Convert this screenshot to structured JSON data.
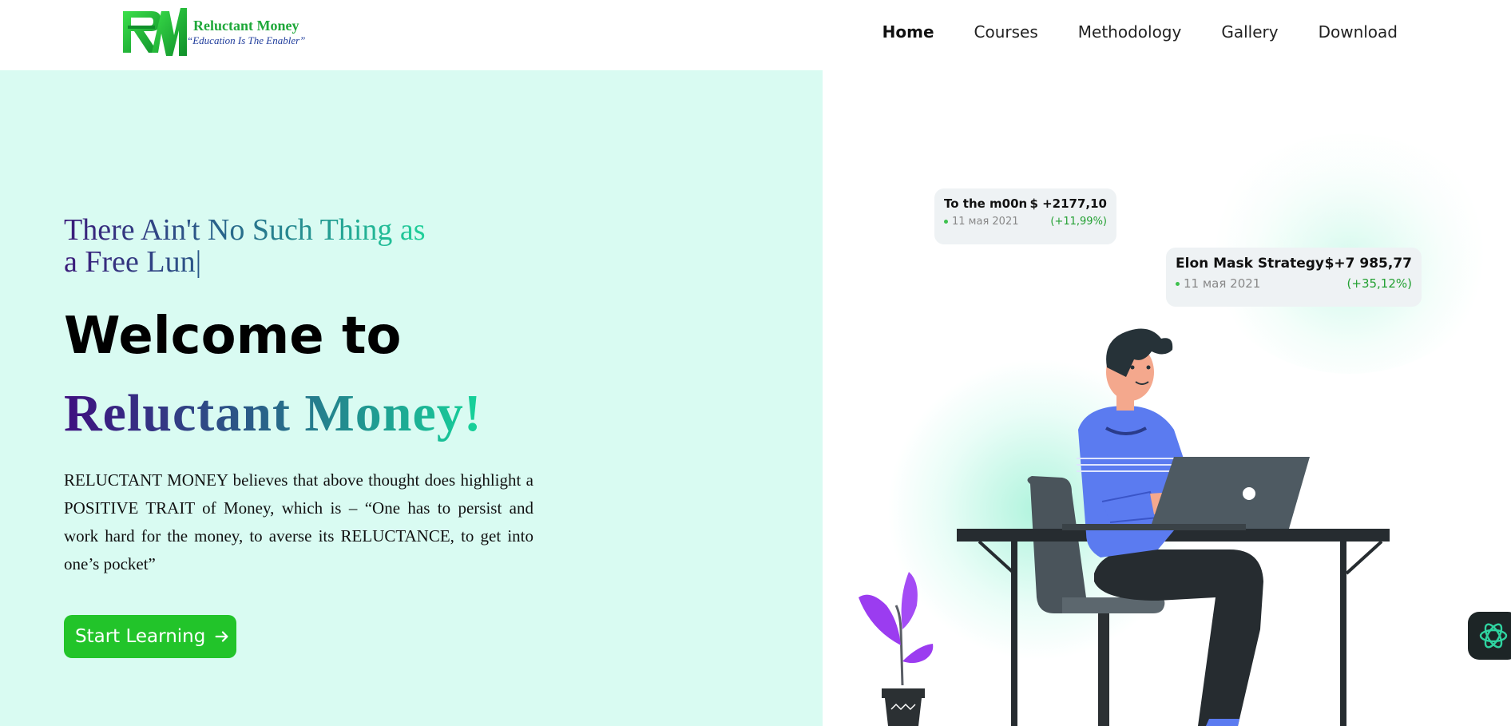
{
  "header": {
    "logo": {
      "name": "Reluctant Money",
      "tagline": "“Education Is The Enabler”",
      "mark_color": "#1fbf3a"
    },
    "nav": [
      {
        "label": "Home",
        "active": true
      },
      {
        "label": "Courses",
        "active": false
      },
      {
        "label": "Methodology",
        "active": false
      },
      {
        "label": "Gallery",
        "active": false
      },
      {
        "label": "Download",
        "active": false
      }
    ]
  },
  "hero": {
    "tagline": "There Ain't No Such Thing as a Free Lun|",
    "welcome": "Welcome to",
    "brand": "Reluctant Money!",
    "description": "RELUCTANT MONEY believes that above thought does highlight a POSITIVE TRAIT of Money, which is – “One has to persist and work hard for the money, to averse its RELUCTANCE, to get into one’s pocket”",
    "cta_label": "Start Learning",
    "cta_icon": "arrow-right-icon",
    "cta_color": "#22c42a"
  },
  "cards": [
    {
      "name": "To the m00n",
      "amount": "$ +2177,10",
      "date": "11 мая 2021",
      "change": "(+11,99%)"
    },
    {
      "name": "Elon Mask Strategy",
      "amount": "$+7 985,77",
      "date": "11 мая 2021",
      "change": "(+35,12%)"
    }
  ],
  "colors": {
    "hero_left_bg": "#d9fbf2",
    "gradient_start": "#3e0f80",
    "gradient_end": "#16d49a",
    "change_green": "#23a032"
  },
  "widget": {
    "icon": "assistant-knot-icon"
  }
}
